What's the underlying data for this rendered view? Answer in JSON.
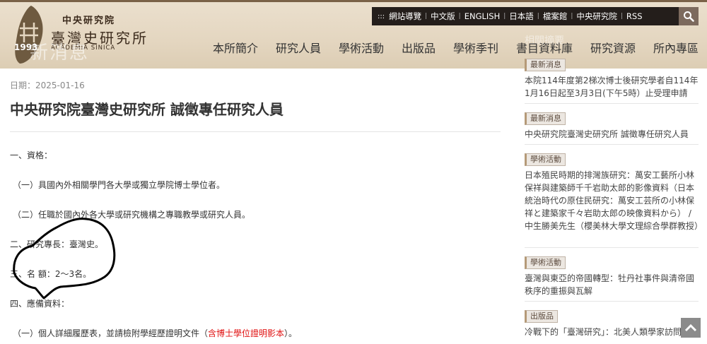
{
  "header": {
    "logo": {
      "line1": "中央研究院",
      "line2": "臺灣史研究所",
      "line3": "ACADEMIA SINICA",
      "year": "1993"
    },
    "ghost_text": "新消息",
    "top_links": [
      "網站導覽",
      "中文版",
      "ENGLISH",
      "日本語",
      "檔案館",
      "中央研究院",
      "RSS"
    ],
    "top_dots": ":::",
    "search_icon": "search-icon",
    "main_nav": [
      "本所簡介",
      "研究人員",
      "學術活動",
      "出版品",
      "學術季刊",
      "書目資料庫",
      "研究資源",
      "所內專區"
    ],
    "side_ghost": "相關摘要"
  },
  "article": {
    "date": "日期：2025-01-16",
    "title": "中央研究院臺灣史研究所 誠徵專任研究人員",
    "paragraphs": [
      "一、資格：",
      "（一）具國內外相關學門各大學或獨立學院博士學位者。",
      "（二）任職於國內外各大學或研究機構之專職教學或研究人員。",
      "二、研究專長：臺灣史。",
      "三、名 額：2～3名。",
      "四、應備資料："
    ],
    "last_para_prefix": "（一）個人詳細履歷表，並請檢附學經歷證明文件（",
    "last_para_red": "含博士學位證明影本",
    "last_para_suffix": "）。"
  },
  "sidebar": {
    "items": [
      {
        "badge": "最新消息",
        "text": "本院114年度第2梯次博士後研究學者自114年1月16日起至3月3日(下午5時）止受理申請"
      },
      {
        "badge": "最新消息",
        "text": "中央研究院臺灣史研究所 誠徵專任研究人員"
      },
      {
        "badge": "學術活動",
        "text": "日本殖民時期的排灣族研究：萬安工藝所小林保祥與建築師千千岩助太郎的影像資料（日本統治時代の原住民研究：萬安工芸所の小林保祥と建築家千々岩助太郎の映像資料から） / 中生勝美先生（櫻美林大學文理綜合學群教授）"
      },
      {
        "badge": "學術活動",
        "text": "臺灣與東亞的帝國轉型：牡丹社事件與清帝國秩序的重振與瓦解"
      },
      {
        "badge": "出版品",
        "text": "冷戰下的「臺灣研究」：北美人類學家訪問紀錄"
      }
    ]
  },
  "back_to_top_icon": "chevron-up-icon",
  "colors": {
    "header_bg": "#e4d6c0",
    "topbar_bg": "#241e1b",
    "search_bg": "#7c6a5d",
    "highlight_red": "#e01010"
  }
}
